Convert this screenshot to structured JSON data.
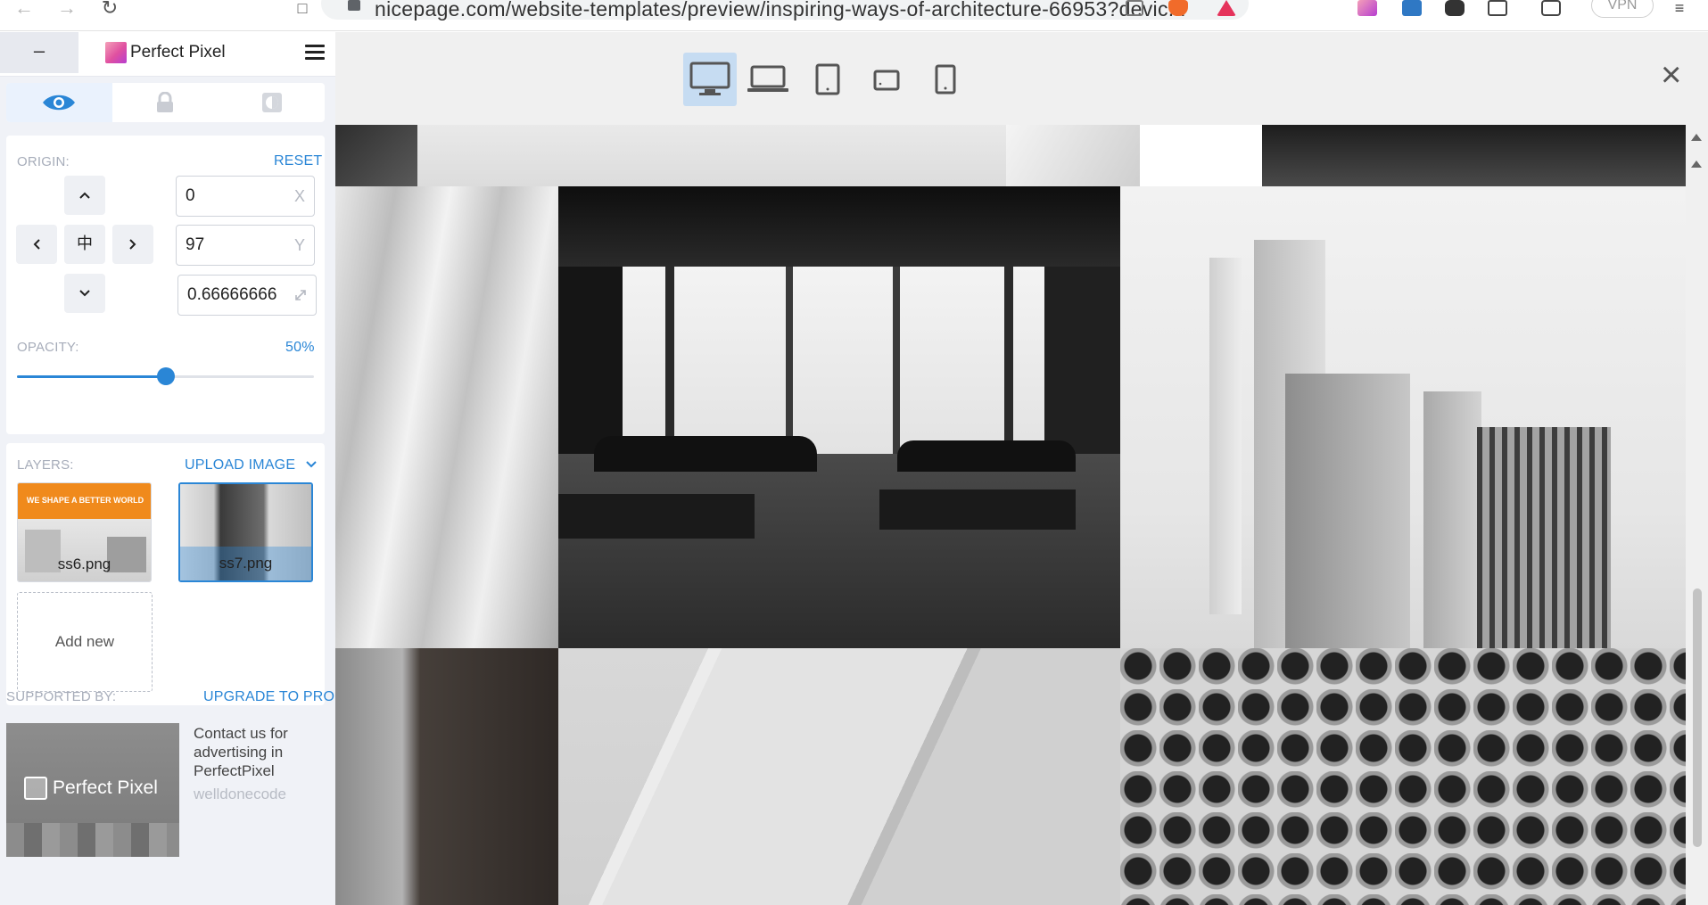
{
  "browser": {
    "url": "nicepage.com/website-templates/preview/inspiring-ways-of-architecture-66953?devic...",
    "vpn_label": "VPN"
  },
  "panel": {
    "minimize_label": "–",
    "app_name": "Perfect Pixel",
    "origin": {
      "label": "ORIGIN:",
      "reset_label": "RESET",
      "x_value": "0",
      "x_suffix": "X",
      "y_value": "97",
      "y_suffix": "Y",
      "scale_value": "0.66666666",
      "center_glyph": "中"
    },
    "opacity": {
      "label": "OPACITY:",
      "value_text": "50%",
      "value": 0.5
    },
    "layers": {
      "label": "LAYERS:",
      "upload_label": "UPLOAD IMAGE",
      "items": [
        {
          "name": "ss6.png",
          "banner": "WE SHAPE A BETTER WORLD",
          "selected": false
        },
        {
          "name": "ss7.png",
          "selected": true
        }
      ],
      "add_new_label": "Add new"
    },
    "supported_by_label": "SUPPORTED BY:",
    "upgrade_label": "UPGRADE TO PRO",
    "ad": {
      "logo_text": "Perfect Pixel",
      "line1": "Contact us for",
      "line2": "advertising in",
      "line3": "PerfectPixel",
      "sponsor": "welldonecode"
    }
  },
  "colors": {
    "accent": "#2a86d6",
    "panel_bg": "#f0f2f7",
    "active_device": "#c6dcf2",
    "banner_orange": "#f08a1c"
  },
  "icons": {
    "view_tab": "eye-icon",
    "lock_tab": "lock-icon",
    "invert_tab": "invert-icon",
    "devices": [
      "desktop-icon",
      "laptop-icon",
      "tablet-portrait-icon",
      "tablet-landscape-icon",
      "phone-icon"
    ]
  }
}
